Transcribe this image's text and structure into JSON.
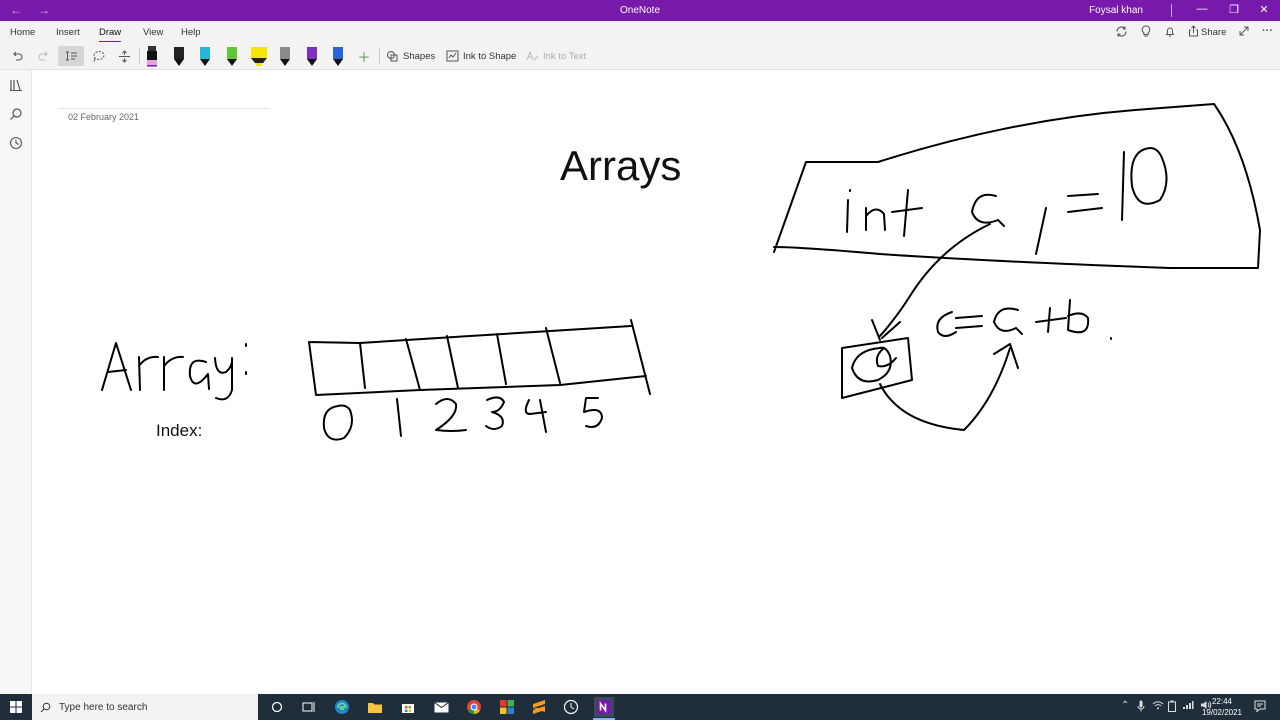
{
  "titlebar": {
    "title": "OneNote",
    "user": "Foysal khan",
    "back_icon": "←",
    "forward_icon": "→",
    "minimize_icon": "—",
    "restore_icon": "❐",
    "close_icon": "✕"
  },
  "menu": {
    "tabs": [
      "Home",
      "Insert",
      "Draw",
      "View",
      "Help"
    ],
    "active_tab": "Draw",
    "share_label": "Share"
  },
  "ribbon": {
    "shapes_label": "Shapes",
    "ink_to_shape_label": "Ink to Shape",
    "ink_to_text_label": "Ink to Text",
    "pens": [
      {
        "name": "pen-pink",
        "color": "#e8a2e0"
      },
      {
        "name": "pen-black-1",
        "color": "#111111"
      },
      {
        "name": "pen-cyan",
        "color": "#29b6d6"
      },
      {
        "name": "pen-green",
        "color": "#5fc736"
      },
      {
        "name": "highlighter-yellow",
        "color": "#f4e600"
      },
      {
        "name": "pen-gray",
        "color": "#8a8a8a"
      },
      {
        "name": "pen-purple",
        "color": "#7a2fbf"
      },
      {
        "name": "pen-blue",
        "color": "#2b62d8"
      }
    ],
    "accent": "#7719aa"
  },
  "page": {
    "date": "02 February 2021",
    "title": "Arrays",
    "index_label": "Index:"
  },
  "taskbar": {
    "search_placeholder": "Type here to search",
    "time": "22:44",
    "date": "19/02/2021"
  }
}
